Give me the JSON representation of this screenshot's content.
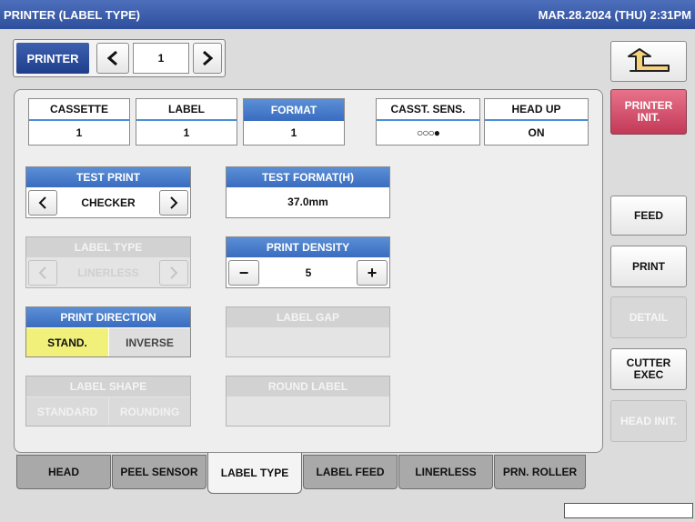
{
  "header": {
    "title": "PRINTER (LABEL TYPE)",
    "datetime": "MAR.28.2024 (THU)  2:31PM"
  },
  "printer_select": {
    "label": "PRINTER",
    "value": "1"
  },
  "status": [
    {
      "label": "CASSETTE",
      "value": "1"
    },
    {
      "label": "LABEL",
      "value": "1"
    },
    {
      "label": "FORMAT",
      "value": "1"
    },
    {
      "label": "CASST. SENS.",
      "value": "○○○●"
    },
    {
      "label": "HEAD UP",
      "value": "ON"
    }
  ],
  "test_print": {
    "label": "TEST PRINT",
    "value": "CHECKER"
  },
  "test_format": {
    "label": "TEST FORMAT(H)",
    "value": "37.0mm"
  },
  "label_type": {
    "label": "LABEL TYPE",
    "value": "LINERLESS"
  },
  "print_density": {
    "label": "PRINT DENSITY",
    "value": "5",
    "minus": "−",
    "plus": "+"
  },
  "print_direction": {
    "label": "PRINT DIRECTION",
    "option1": "STAND.",
    "option2": "INVERSE"
  },
  "label_gap": {
    "label": "LABEL GAP"
  },
  "label_shape": {
    "label": "LABEL SHAPE",
    "option1": "STANDARD",
    "option2": "ROUNDING"
  },
  "round_label": {
    "label": "ROUND LABEL"
  },
  "side_buttons": {
    "printer_init": "PRINTER\nINIT.",
    "feed": "FEED",
    "print": "PRINT",
    "detail": "DETAIL",
    "cutter_exec": "CUTTER\nEXEC",
    "head_init": "HEAD INIT."
  },
  "tabs": [
    "HEAD",
    "PEEL SENSOR",
    "LABEL TYPE",
    "LABEL FEED",
    "LINERLESS",
    "PRN. ROLLER"
  ],
  "active_tab": "LABEL TYPE",
  "colors": {
    "title_blue": "#2e4f9c",
    "accent_blue": "#3a6cc0",
    "selected_yellow": "#f1f07a",
    "init_red": "#d9506a"
  }
}
